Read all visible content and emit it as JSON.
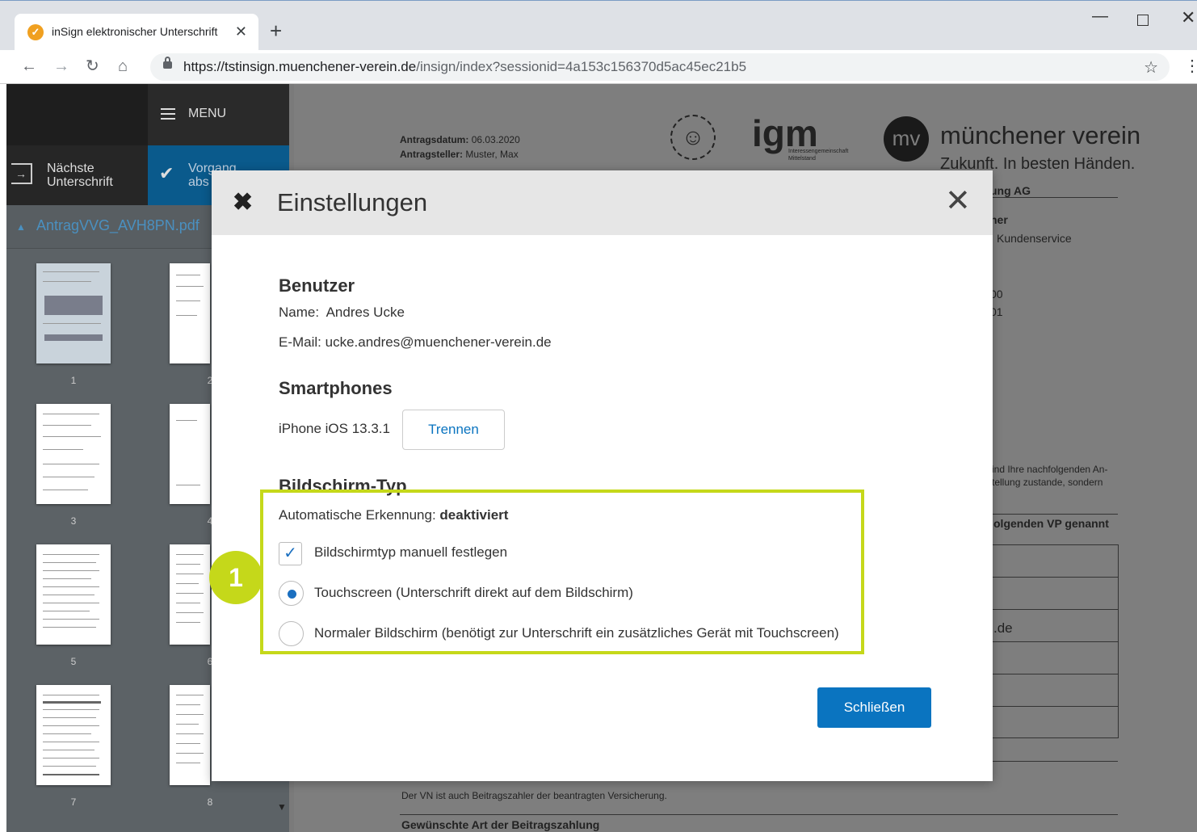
{
  "browser": {
    "tab_title": "inSign elektronischer Unterschrift",
    "tab_close": "✕",
    "new_tab": "+",
    "url_host": "https://tstinsign.muenchener-verein.de",
    "url_path": "/insign/index?sessionid=4a153c156370d5ac45ec21b5",
    "back": "←",
    "forward": "→",
    "reload": "↻",
    "home": "⌂",
    "star": "☆",
    "kebab": "⋮",
    "min": "—",
    "close": "✕"
  },
  "sidebar": {
    "menu_label": "MENU",
    "next_signature_line1": "Nächste",
    "next_signature_line2": "Unterschrift",
    "vorgang_line1": "Vorgang",
    "vorgang_line2": "abs",
    "file_name": "AntragVVG_AVH8PN.pdf",
    "thumbnail_numbers": [
      "1",
      "2",
      "3",
      "4",
      "5",
      "6",
      "7",
      "8"
    ]
  },
  "document": {
    "antragsdatum_label": "Antragsdatum:",
    "antragsdatum_value": "06.03.2020",
    "antragsteller_label": "Antragsteller:",
    "antragsteller_value": "Muster, Max",
    "logo_igm": "igm",
    "logo_igm_sub1": "Interessengemeinschaft",
    "logo_igm_sub2": "Mittelstand",
    "logo_mv_badge": "mv",
    "logo_mv_name": "münchener verein",
    "logo_mv_slogan": "Zukunft. In besten Händen.",
    "right_frag1": "ung AG",
    "right_frag2": "ner",
    "right_frag3": "Kundenservice",
    "right_frag4": "00",
    "right_frag5": "01",
    "right_frag6": "ind Ihre nachfolgenden An-",
    "right_frag7": "tellung zustande, sondern",
    "right_frag8": "olgenden VP genannt",
    "right_frag9": ".de",
    "bottom1": "Der VN ist auch Beitragszahler der beantragten Versicherung.",
    "bottom2": "Gewünschte Art der Beitragszahlung"
  },
  "modal": {
    "title": "Einstellungen",
    "close": "✕",
    "benutzer_heading": "Benutzer",
    "name_label": "Name:",
    "name_value": "Andres Ucke",
    "email_label": "E-Mail:",
    "email_value": "ucke.andres@muenchener-verein.de",
    "smartphones_heading": "Smartphones",
    "device": "iPhone iOS 13.3.1",
    "trennen_button": "Trennen",
    "bildschirm_heading": "Bildschirm-Typ",
    "auto_label": "Automatische Erkennung:",
    "auto_value": "deaktiviert",
    "manual_checkbox_label": "Bildschirmtyp manuell festlegen",
    "manual_checked": true,
    "option_touch": "Touchscreen (Unterschrift direkt auf dem Bildschirm)",
    "option_normal": "Normaler Bildschirm (benötigt zur Unterschrift ein zusätzliches Gerät mit Touchscreen)",
    "selected_option": "touch",
    "close_button": "Schließen"
  },
  "annotation": {
    "badge_number": "1",
    "highlight_color": "#c5d81a"
  },
  "colors": {
    "accent": "#0a74c0",
    "header_dark": "#1e1e1e",
    "vorgang_blue": "#0a5a8c"
  }
}
